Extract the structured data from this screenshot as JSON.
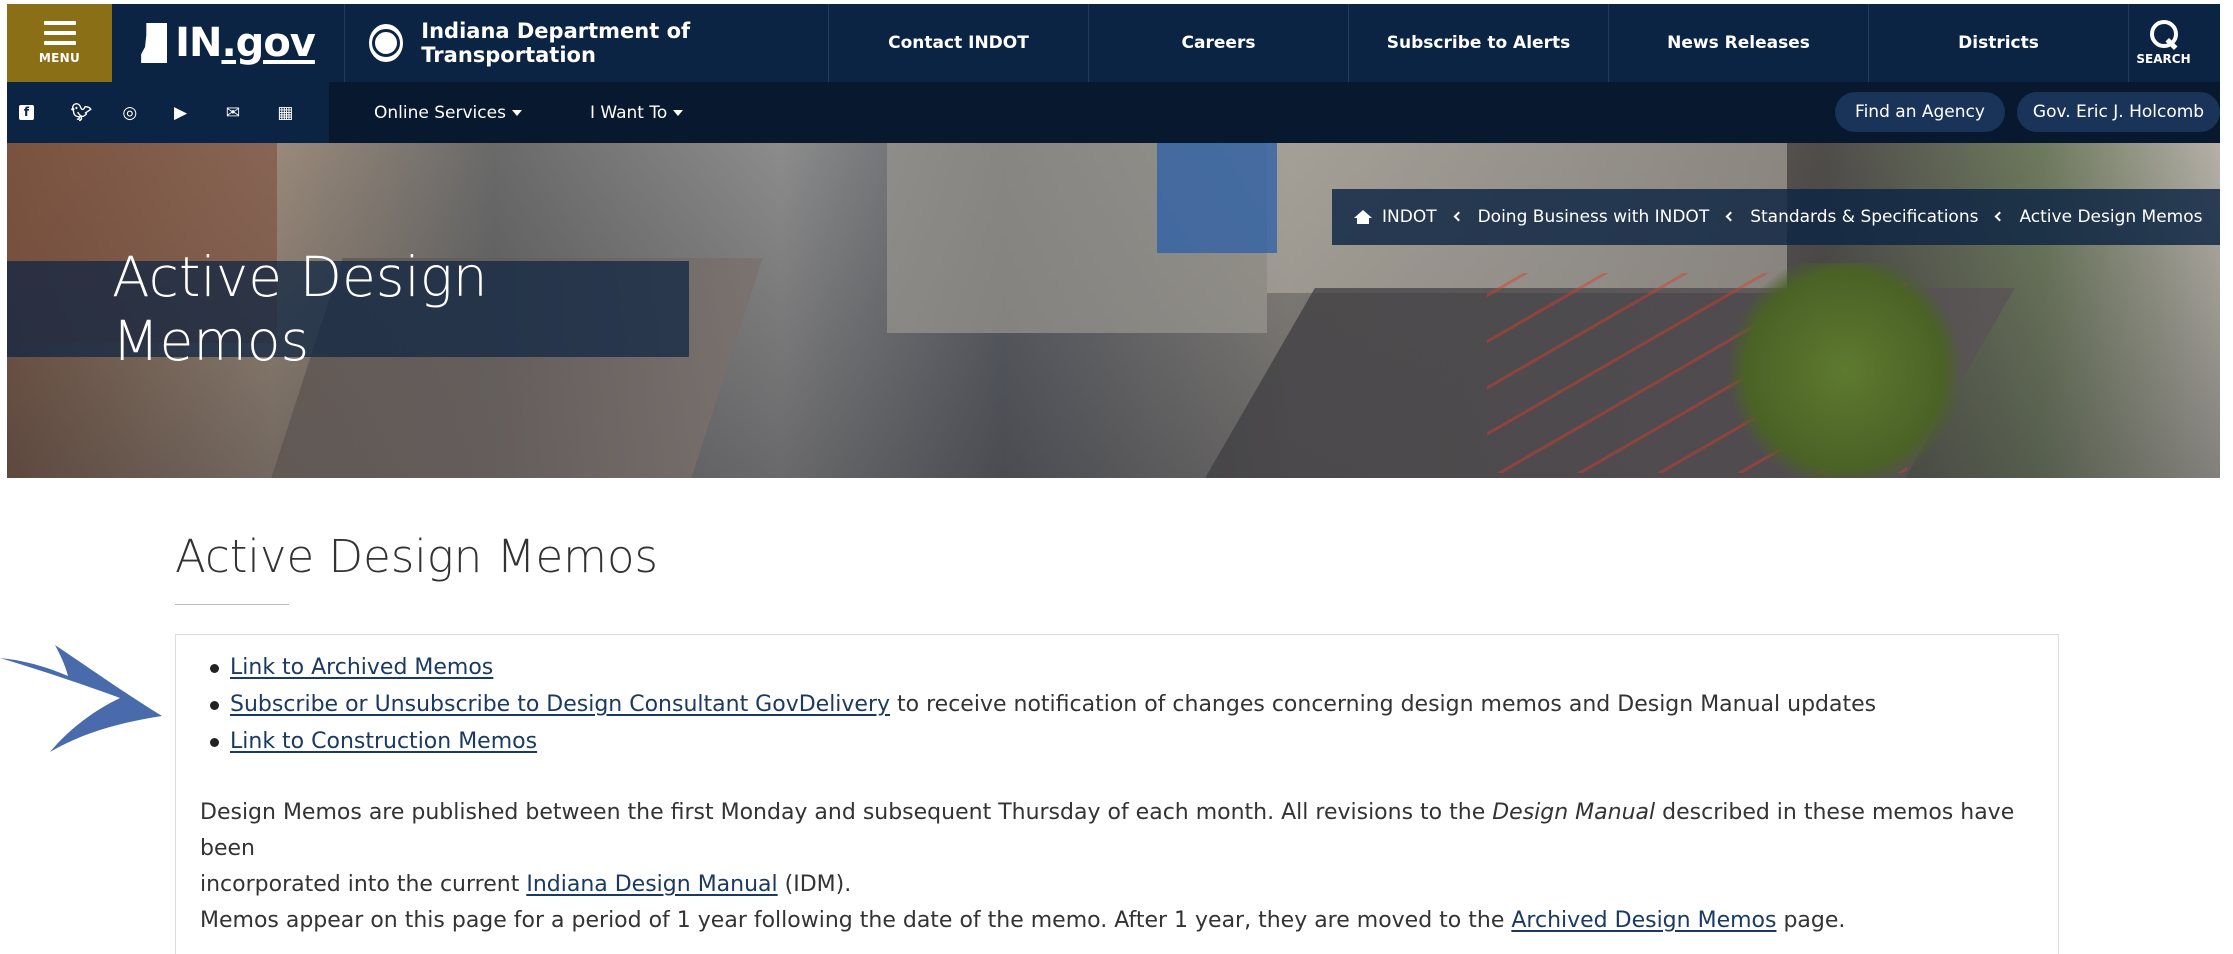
{
  "header": {
    "menu_label": "MENU",
    "logo_text": "IN",
    "logo_suffix": ".gov",
    "department": "Indiana Department of Transportation",
    "nav": [
      "Contact INDOT",
      "Careers",
      "Subscribe to Alerts",
      "News Releases",
      "Districts"
    ],
    "search_label": "SEARCH"
  },
  "subbar": {
    "social_icons": [
      "facebook-icon",
      "twitter-icon",
      "instagram-icon",
      "youtube-icon",
      "email-icon",
      "calendar-icon"
    ],
    "online_services": "Online Services",
    "i_want_to": "I Want To",
    "find_agency": "Find an Agency",
    "governor": "Gov. Eric J. Holcomb"
  },
  "hero": {
    "title": "Active Design Memos",
    "breadcrumb": [
      "INDOT",
      "Doing Business with INDOT",
      "Standards & Specifications",
      "Active Design Memos"
    ]
  },
  "main": {
    "title": "Active Design Memos",
    "links": {
      "archived": "Link to Archived Memos",
      "subscribe": "Subscribe or Unsubscribe to Design Consultant GovDelivery",
      "subscribe_rest": " to receive notification of changes concerning design memos and Design Manual updates",
      "construction": "Link to Construction Memos"
    },
    "para1": {
      "start": "Design Memos are published between the first Monday and subsequent Thursday of each month. All revisions to the ",
      "italic": "Design Manual",
      "mid": " described in these memos have been",
      "line2_start": "incorporated into the current ",
      "link": "Indiana Design Manual",
      "end": " (IDM)."
    },
    "para2": {
      "start": "Memos appear on this page for a period of 1 year following the date of the memo. After 1 year, they are moved to the ",
      "link": "Archived Design Memos",
      "end": " page."
    }
  },
  "colors": {
    "navy": "#0c2443",
    "gold": "#8a6f16",
    "link": "#1b3a63",
    "arrow": "#3f63a8"
  }
}
